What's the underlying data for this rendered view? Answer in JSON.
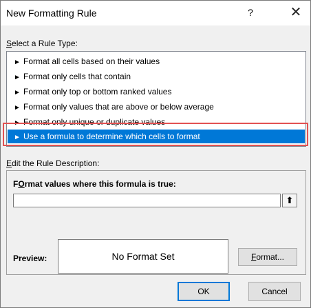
{
  "window": {
    "title": "New Formatting Rule",
    "help_label": "?",
    "close_label": "✕"
  },
  "rule_type": {
    "label_accel": "S",
    "label_rest": "elect a Rule Type:",
    "items": [
      {
        "label": "Format all cells based on their values"
      },
      {
        "label": "Format only cells that contain"
      },
      {
        "label": "Format only top or bottom ranked values"
      },
      {
        "label": "Format only values that are above or below average"
      },
      {
        "label": "Format only unique or duplicate values"
      },
      {
        "label": "Use a formula to determine which cells to format",
        "selected": true
      }
    ],
    "bullet": "►"
  },
  "description": {
    "label_accel": "E",
    "label_rest": "dit the Rule Description:",
    "formula_label_accel": "O",
    "formula_label_pre": "F",
    "formula_label_rest": "rmat values where this formula is true:",
    "formula_value": "",
    "collapse_icon": "⬆"
  },
  "preview": {
    "label": "Preview:",
    "text": "No Format Set"
  },
  "buttons": {
    "format_accel": "F",
    "format_rest": "ormat...",
    "ok": "OK",
    "cancel": "Cancel"
  }
}
